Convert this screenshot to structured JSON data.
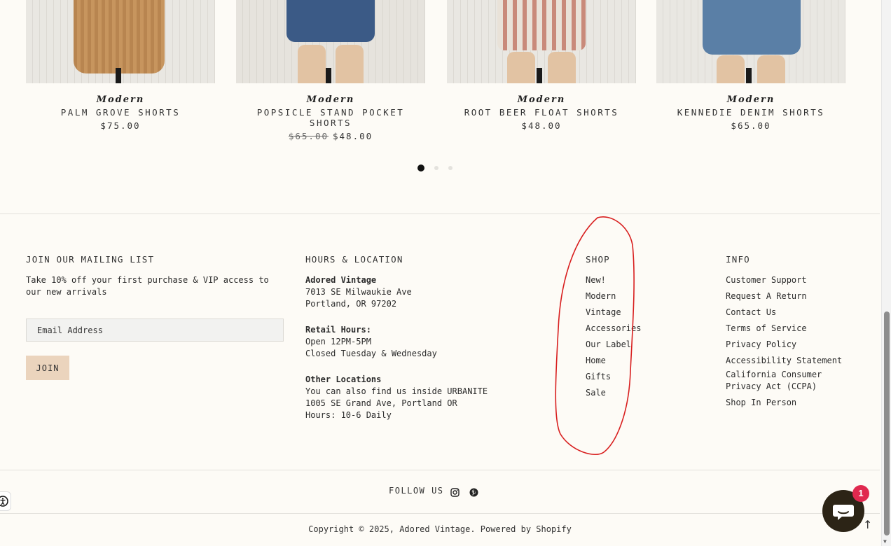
{
  "products": [
    {
      "brand": "Modern",
      "name": "PALM GROVE SHORTS",
      "price": "$75.00",
      "compare_price": ""
    },
    {
      "brand": "Modern",
      "name": "POPSICLE STAND POCKET SHORTS",
      "price": "$48.00",
      "compare_price": "$65.00"
    },
    {
      "brand": "Modern",
      "name": "ROOT BEER FLOAT SHORTS",
      "price": "$48.00",
      "compare_price": ""
    },
    {
      "brand": "Modern",
      "name": "KENNEDIE DENIM SHORTS",
      "price": "$65.00",
      "compare_price": ""
    }
  ],
  "carousel": {
    "pages": 3,
    "active_page": 1
  },
  "mailing": {
    "title": "JOIN OUR MAILING LIST",
    "text": "Take 10% off your first purchase & VIP access to our new arrivals",
    "email_placeholder": "Email Address",
    "join_label": "JOIN"
  },
  "hours": {
    "title": "HOURS & LOCATION",
    "store_name": "Adored Vintage",
    "address1": "7013 SE Milwaukie Ave",
    "address2": "Portland, OR 97202",
    "retail_heading": "Retail Hours:",
    "retail_line1": "Open 12PM-5PM",
    "retail_line2": "Closed Tuesday & Wednesday",
    "other_heading": "Other Locations",
    "other_line1": "You can also find us inside URBANITE",
    "other_line2": "1005 SE Grand Ave, Portland OR",
    "other_line3": "Hours: 10-6 Daily"
  },
  "shop": {
    "title": "SHOP",
    "links": [
      "New!",
      "Modern",
      "Vintage",
      "Accessories",
      "Our Label",
      "Home",
      "Gifts",
      "Sale"
    ]
  },
  "info": {
    "title": "INFO",
    "links": [
      "Customer Support",
      "Request A Return",
      "Contact Us",
      "Terms of Service",
      "Privacy Policy",
      "Accessibility Statement",
      "California Consumer Privacy Act (CCPA)",
      "Shop In Person"
    ]
  },
  "follow": {
    "label": "FOLLOW US",
    "icons": [
      "instagram-icon",
      "pinterest-icon"
    ]
  },
  "copyright": "Copyright © 2025, Adored Vintage. Powered by Shopify",
  "chat": {
    "badge_count": "1"
  },
  "colors": {
    "background": "#fdfbf6",
    "join_button": "#ebd4bd",
    "annotation": "#d81e1e",
    "chat": "#2c2416",
    "badge": "#e0294f"
  }
}
